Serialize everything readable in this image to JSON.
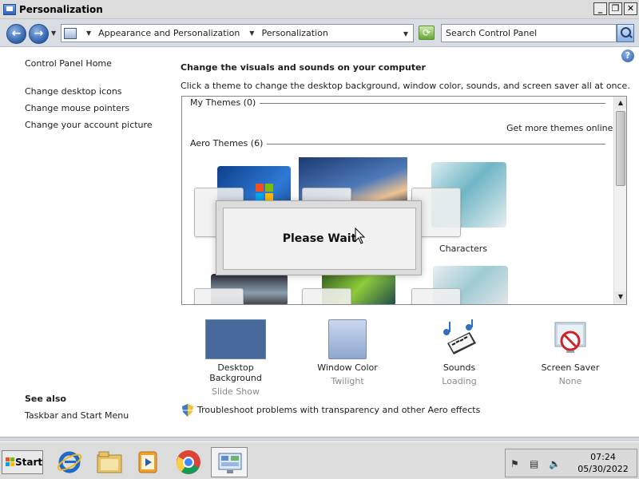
{
  "window": {
    "title": "Personalization",
    "controls": {
      "minimize": "_",
      "maximize": "❐",
      "close": "✕"
    }
  },
  "address_bar": {
    "breadcrumbs": [
      "Appearance and Personalization",
      "Personalization"
    ],
    "search_placeholder": "Search Control Panel"
  },
  "sidebar": {
    "home": "Control Panel Home",
    "links": [
      "Change desktop icons",
      "Change mouse pointers",
      "Change your account picture"
    ],
    "see_also_title": "See also",
    "see_also_links": [
      "Taskbar and Start Menu"
    ]
  },
  "main": {
    "heading": "Change the visuals and sounds on your computer",
    "subheading": "Click a theme to change the desktop background, window color, sounds, and screen saver all at once.",
    "my_themes_label": "My Themes (0)",
    "more_themes_link": "Get more themes online",
    "aero_themes_label": "Aero Themes (6)",
    "visible_theme_names": [
      "Characters"
    ],
    "dialog_text": "Please Wait"
  },
  "customizations": [
    {
      "label": "Desktop Background",
      "value": "Slide Show",
      "icon": "desktop-background-icon"
    },
    {
      "label": "Window Color",
      "value": "Twilight",
      "icon": "window-color-icon"
    },
    {
      "label": "Sounds",
      "value": "Loading",
      "icon": "sounds-icon"
    },
    {
      "label": "Screen Saver",
      "value": "None",
      "icon": "screen-saver-icon"
    }
  ],
  "troubleshoot_link": "Troubleshoot problems with transparency and other Aero effects",
  "taskbar": {
    "start_label": "Start",
    "pinned": [
      "internet-explorer-icon",
      "explorer-icon",
      "media-player-icon",
      "chrome-icon",
      "control-panel-icon"
    ],
    "clock_time": "07:24",
    "clock_date": "05/30/2022"
  },
  "colors": {
    "desktop_background_swatch": "#46689a",
    "window_color_swatch": "#a9bde0",
    "taskbar": "#dcdcdc"
  }
}
